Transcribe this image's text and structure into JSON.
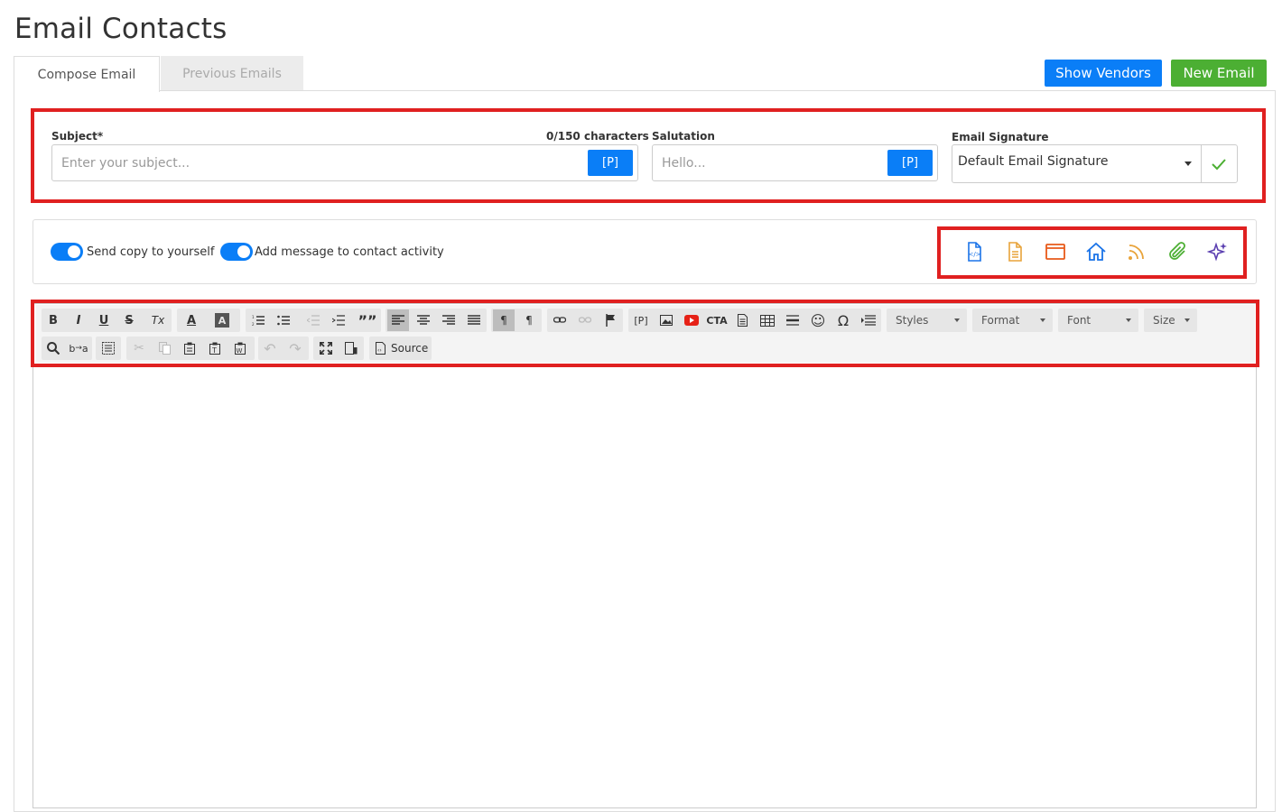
{
  "page": {
    "title": "Email Contacts"
  },
  "tabs": [
    {
      "label": "Compose Email",
      "active": true
    },
    {
      "label": "Previous Emails",
      "active": false
    }
  ],
  "header_buttons": {
    "show_vendors": "Show Vendors",
    "new_email": "New Email"
  },
  "form": {
    "subject": {
      "label": "Subject*",
      "counter": "0/150 characters",
      "placeholder": "Enter your subject...",
      "placeholder_button": "[P]"
    },
    "salutation": {
      "label": "Salutation",
      "placeholder": "Hello...",
      "placeholder_button": "[P]"
    },
    "signature": {
      "label": "Email Signature",
      "selected": "Default Email Signature"
    }
  },
  "options": {
    "send_copy": {
      "label": "Send copy to yourself",
      "on": true
    },
    "add_activity": {
      "label": "Add message to contact activity",
      "on": true
    }
  },
  "quick_tools": [
    {
      "icon": "html-file-icon",
      "color": "#1a73e8"
    },
    {
      "icon": "document-icon",
      "color": "#e8a33a"
    },
    {
      "icon": "browser-window-icon",
      "color": "#e85a1a"
    },
    {
      "icon": "home-icon",
      "color": "#1a73e8"
    },
    {
      "icon": "rss-icon",
      "color": "#e8a33a"
    },
    {
      "icon": "paperclip-icon",
      "color": "#4caf33"
    },
    {
      "icon": "ai-sparkle-icon",
      "color": "#5b3fb0"
    }
  ],
  "editor_toolbar": {
    "styles": "Styles",
    "format": "Format",
    "font": "Font",
    "size": "Size",
    "source": "Source",
    "row1_buttons": [
      "bold-icon",
      "italic-icon",
      "underline-icon",
      "strike-icon",
      "remove-format-icon",
      "text-color-icon",
      "bg-color-icon",
      "numbered-list-icon",
      "bullet-list-icon",
      "outdent-icon",
      "indent-icon",
      "blockquote-icon",
      "align-left-icon",
      "align-center-icon",
      "align-right-icon",
      "justify-icon",
      "ltr-icon",
      "rtl-icon",
      "link-icon",
      "unlink-icon",
      "anchor-icon",
      "placeholder-icon",
      "image-icon",
      "youtube-icon",
      "cta-icon",
      "template-icon",
      "table-icon",
      "horizontal-line-icon",
      "smiley-icon",
      "special-char-icon",
      "page-break-icon"
    ],
    "glyphs": {
      "bold": "B",
      "italic": "I",
      "underline": "U",
      "strike": "S",
      "removeformat": "Tx",
      "textcolor": "A",
      "bgcolor": "A",
      "blockquote": "””",
      "ltr": "¶",
      "rtl": "¶",
      "placeholder": "[P]",
      "cta": "CTA",
      "smiley": "☺",
      "omega": "Ω",
      "search": "⌕",
      "undo": "↶",
      "redo": "↷"
    }
  }
}
